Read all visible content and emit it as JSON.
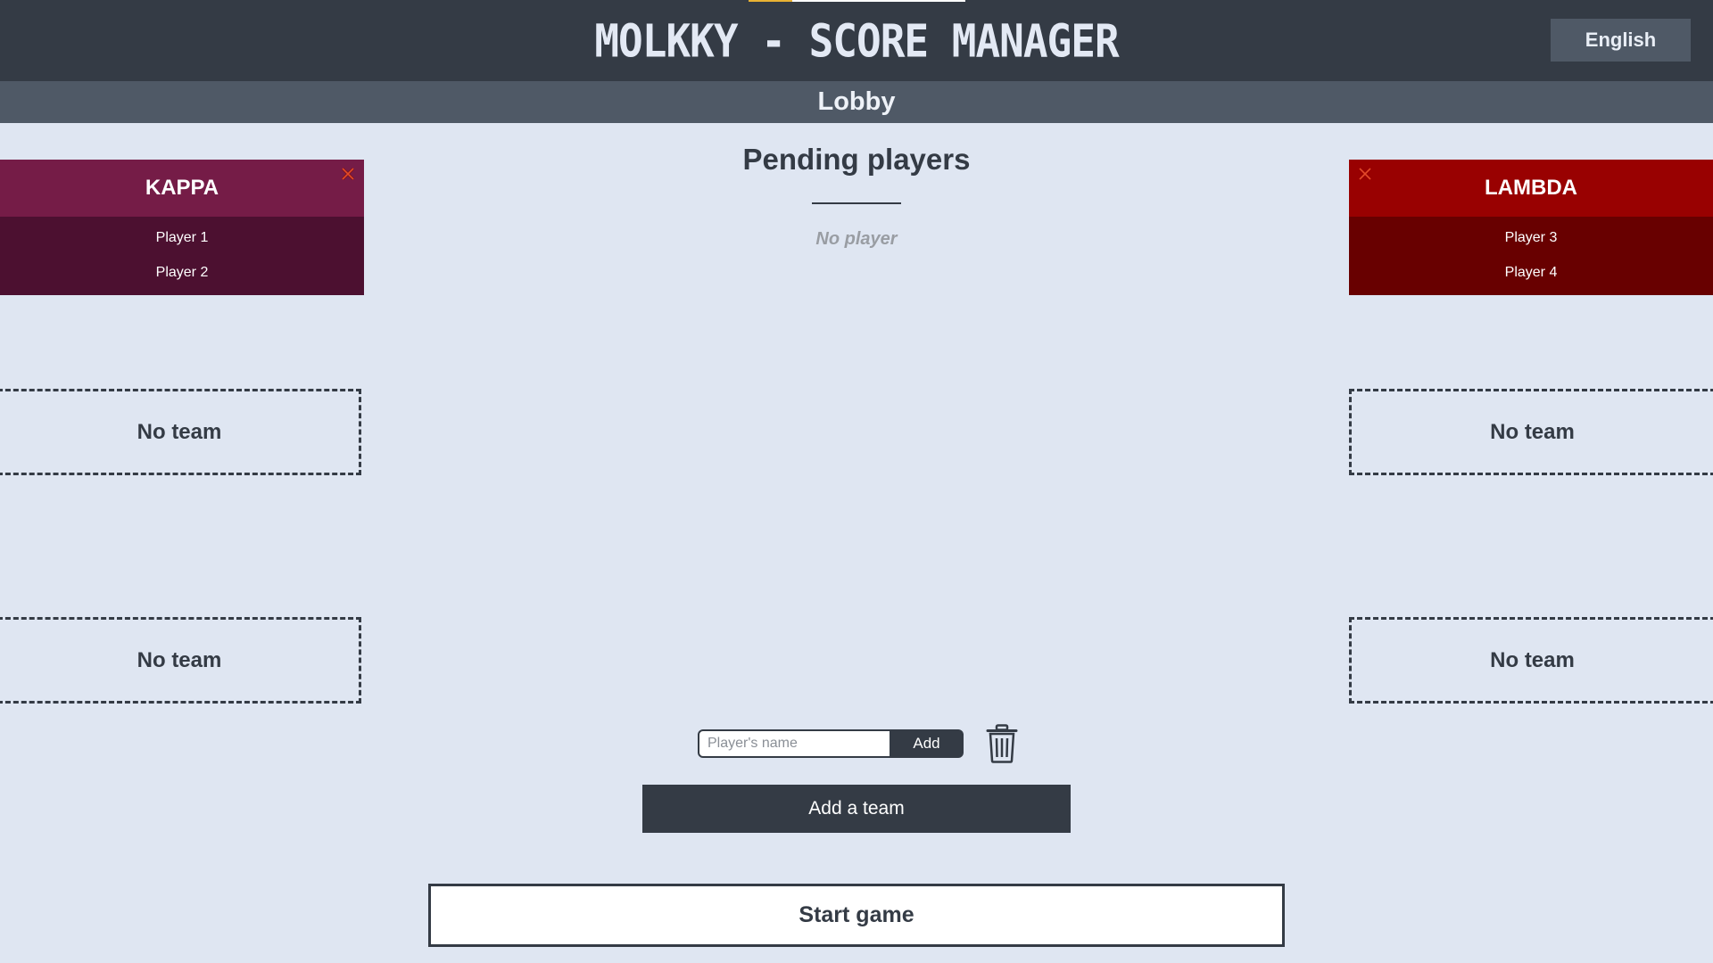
{
  "header": {
    "title": "MOLKKY - SCORE MANAGER",
    "language_label": "English"
  },
  "subheader": {
    "title": "Lobby"
  },
  "teams": [
    {
      "name": "KAPPA",
      "color": "#751c47",
      "players": [
        "Player 1",
        "Player 2"
      ]
    },
    {
      "name": "LAMBDA",
      "color": "#990101",
      "players": [
        "Player 3",
        "Player 4"
      ]
    }
  ],
  "empty_slots": [
    "No team",
    "No team",
    "No team",
    "No team"
  ],
  "pending": {
    "title": "Pending players",
    "empty_text": "No player"
  },
  "add_player": {
    "placeholder": "Player's name",
    "button_label": "Add"
  },
  "actions": {
    "add_team_label": "Add a team",
    "start_game_label": "Start game"
  },
  "icons": {
    "close": "close-icon",
    "trash": "trash-icon"
  }
}
